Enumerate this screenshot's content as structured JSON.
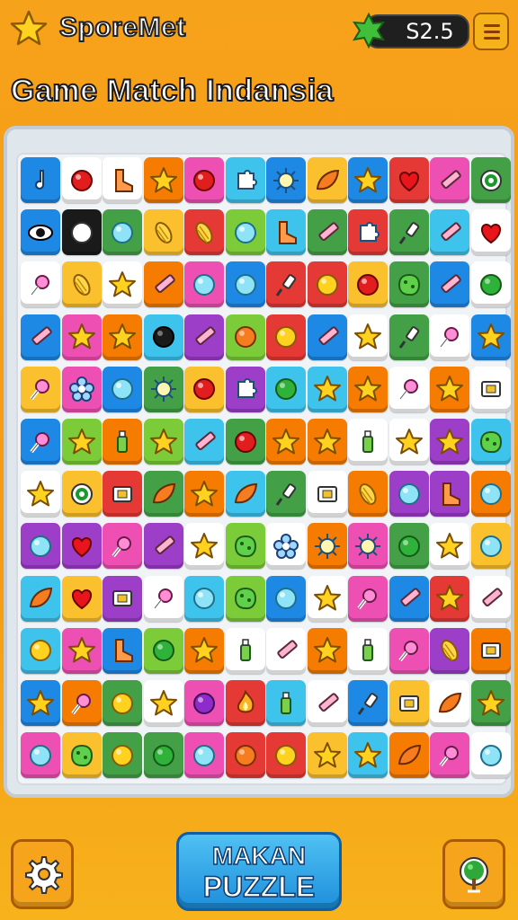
{
  "header": {
    "app_title": "SporeMet",
    "score": "S2.5",
    "menu_icon": "hamburger-menu-icon",
    "left_icon": "star-icon",
    "score_icon": "gem-icon"
  },
  "game_title": "Game Match Indansia",
  "colors": {
    "b": "#1e88e5",
    "w": "#ffffff",
    "o": "#f57c00",
    "p": "#ee4fb3",
    "c": "#3ec3ec",
    "y": "#fbc02d",
    "r": "#e53935",
    "g": "#43a047",
    "v": "#9c3ec8",
    "k": "#1a1a1a",
    "l": "#7ccc3a",
    "m": "#f6a11c"
  },
  "board": {
    "rows": [
      [
        [
          "b",
          "music"
        ],
        [
          "w",
          "ball-red"
        ],
        [
          "w",
          "boot"
        ],
        [
          "o",
          "star"
        ],
        [
          "p",
          "ball-red"
        ],
        [
          "c",
          "puzzle"
        ],
        [
          "b",
          "sun"
        ],
        [
          "y",
          "leaf"
        ],
        [
          "b",
          "star"
        ],
        [
          "r",
          "heart"
        ],
        [
          "p",
          "pencil"
        ],
        [
          "g",
          "ring"
        ]
      ],
      [
        [
          "b",
          "eye"
        ],
        [
          "k",
          "ball-white"
        ],
        [
          "g",
          "ball-cyan"
        ],
        [
          "y",
          "corn"
        ],
        [
          "r",
          "corn"
        ],
        [
          "l",
          "ball-cyan"
        ],
        [
          "c",
          "boot"
        ],
        [
          "g",
          "pencil"
        ],
        [
          "r",
          "puzzle"
        ],
        [
          "g",
          "pin"
        ],
        [
          "c",
          "pencil"
        ],
        [
          "w",
          "heart"
        ]
      ],
      [
        [
          "w",
          "candy"
        ],
        [
          "y",
          "corn"
        ],
        [
          "w",
          "star"
        ],
        [
          "o",
          "pencil"
        ],
        [
          "p",
          "ball-cyan"
        ],
        [
          "b",
          "ball-cyan"
        ],
        [
          "r",
          "pin"
        ],
        [
          "r",
          "ball-yellow"
        ],
        [
          "y",
          "ball-red"
        ],
        [
          "g",
          "blob"
        ],
        [
          "b",
          "pencil"
        ],
        [
          "w",
          "ball-green"
        ]
      ],
      [
        [
          "b",
          "pencil"
        ],
        [
          "p",
          "star"
        ],
        [
          "o",
          "star"
        ],
        [
          "c",
          "ball-black"
        ],
        [
          "v",
          "pencil"
        ],
        [
          "l",
          "ball-orange"
        ],
        [
          "r",
          "ball-yellow"
        ],
        [
          "b",
          "pencil"
        ],
        [
          "w",
          "star"
        ],
        [
          "g",
          "pin"
        ],
        [
          "w",
          "candy"
        ],
        [
          "b",
          "star"
        ]
      ],
      [
        [
          "y",
          "candy"
        ],
        [
          "p",
          "flower"
        ],
        [
          "b",
          "ball-cyan"
        ],
        [
          "g",
          "sun"
        ],
        [
          "y",
          "ball-red"
        ],
        [
          "v",
          "puzzle"
        ],
        [
          "c",
          "ball-green"
        ],
        [
          "c",
          "star"
        ],
        [
          "o",
          "star"
        ],
        [
          "w",
          "candy"
        ],
        [
          "o",
          "star"
        ],
        [
          "w",
          "box"
        ]
      ],
      [
        [
          "b",
          "candy"
        ],
        [
          "l",
          "star"
        ],
        [
          "o",
          "bottle"
        ],
        [
          "l",
          "star"
        ],
        [
          "c",
          "pencil"
        ],
        [
          "g",
          "ball-red"
        ],
        [
          "o",
          "star"
        ],
        [
          "o",
          "star"
        ],
        [
          "w",
          "bottle"
        ],
        [
          "w",
          "star"
        ],
        [
          "v",
          "star"
        ],
        [
          "c",
          "blob"
        ]
      ],
      [
        [
          "w",
          "star"
        ],
        [
          "y",
          "ring"
        ],
        [
          "r",
          "box"
        ],
        [
          "g",
          "leaf"
        ],
        [
          "o",
          "star"
        ],
        [
          "c",
          "leaf"
        ],
        [
          "g",
          "pin"
        ],
        [
          "w",
          "box"
        ],
        [
          "o",
          "corn"
        ],
        [
          "v",
          "ball-cyan"
        ],
        [
          "v",
          "boot"
        ],
        [
          "o",
          "ball-cyan"
        ]
      ],
      [
        [
          "v",
          "ball-cyan"
        ],
        [
          "v",
          "heart"
        ],
        [
          "p",
          "candy"
        ],
        [
          "v",
          "pencil"
        ],
        [
          "w",
          "star"
        ],
        [
          "l",
          "blob"
        ],
        [
          "w",
          "flower"
        ],
        [
          "o",
          "sun"
        ],
        [
          "p",
          "sun"
        ],
        [
          "g",
          "ball-green"
        ],
        [
          "w",
          "star"
        ],
        [
          "y",
          "ball-cyan"
        ]
      ],
      [
        [
          "c",
          "leaf"
        ],
        [
          "y",
          "heart"
        ],
        [
          "v",
          "box"
        ],
        [
          "w",
          "candy"
        ],
        [
          "c",
          "ball-cyan"
        ],
        [
          "l",
          "blob"
        ],
        [
          "b",
          "ball-cyan"
        ],
        [
          "w",
          "star"
        ],
        [
          "p",
          "candy"
        ],
        [
          "b",
          "pencil"
        ],
        [
          "r",
          "star"
        ],
        [
          "w",
          "pencil"
        ]
      ],
      [
        [
          "c",
          "ball-yellow"
        ],
        [
          "p",
          "star"
        ],
        [
          "b",
          "boot"
        ],
        [
          "l",
          "ball-green"
        ],
        [
          "o",
          "star"
        ],
        [
          "w",
          "bottle"
        ],
        [
          "w",
          "pencil"
        ],
        [
          "o",
          "star"
        ],
        [
          "w",
          "bottle"
        ],
        [
          "p",
          "candy"
        ],
        [
          "v",
          "corn"
        ],
        [
          "o",
          "box"
        ]
      ],
      [
        [
          "b",
          "star"
        ],
        [
          "o",
          "candy"
        ],
        [
          "g",
          "ball-yellow"
        ],
        [
          "w",
          "star"
        ],
        [
          "p",
          "ball-purple"
        ],
        [
          "r",
          "fire"
        ],
        [
          "c",
          "bottle"
        ],
        [
          "w",
          "pencil"
        ],
        [
          "b",
          "pin"
        ],
        [
          "y",
          "box"
        ],
        [
          "w",
          "leaf"
        ],
        [
          "g",
          "star"
        ]
      ],
      [
        [
          "p",
          "ball-cyan"
        ],
        [
          "y",
          "blob"
        ],
        [
          "g",
          "ball-yellow"
        ],
        [
          "g",
          "ball-green"
        ],
        [
          "p",
          "ball-cyan"
        ],
        [
          "r",
          "ball-orange"
        ],
        [
          "r",
          "ball-yellow"
        ],
        [
          "y",
          "star"
        ],
        [
          "c",
          "star"
        ],
        [
          "o",
          "leaf"
        ],
        [
          "p",
          "candy"
        ],
        [
          "w",
          "ball-cyan"
        ]
      ]
    ]
  },
  "footer": {
    "play_line1": "MAKAN",
    "play_line2": "PUZZLE",
    "left_icon": "settings-gear-icon",
    "right_icon": "tree-icon"
  }
}
